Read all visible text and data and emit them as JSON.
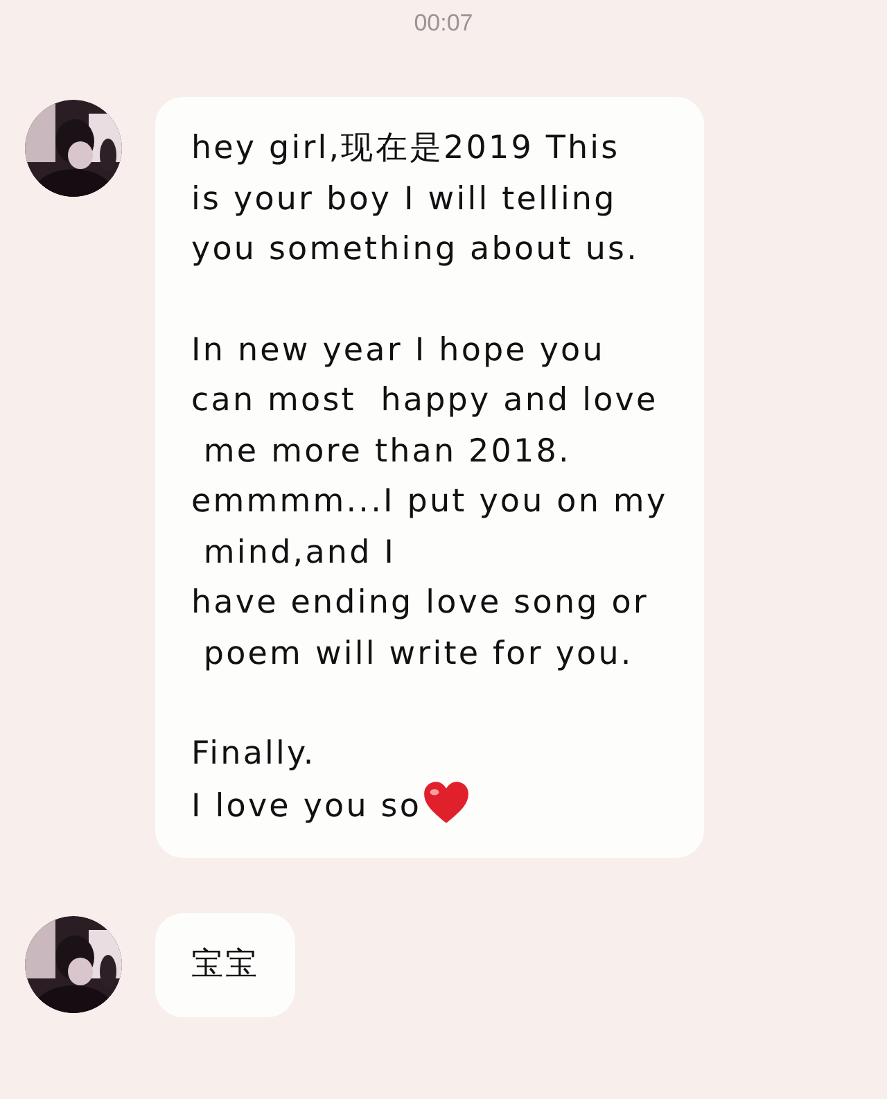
{
  "time": "00:07",
  "messages": [
    {
      "paragraphs": [
        [
          "hey girl,现在是2019 This",
          "is your boy I will telling",
          "you something about us."
        ],
        [
          "In new year I hope you",
          "can most  happy and love",
          " me more than 2018.",
          "emmmm...I put you on my",
          " mind,and I",
          "have ending love song or",
          " poem will write for you."
        ],
        [
          "Finally.",
          "I love you so"
        ]
      ],
      "ends_with_icon": true
    },
    {
      "paragraphs": [
        [
          "宝宝"
        ]
      ],
      "ends_with_icon": false
    }
  ]
}
